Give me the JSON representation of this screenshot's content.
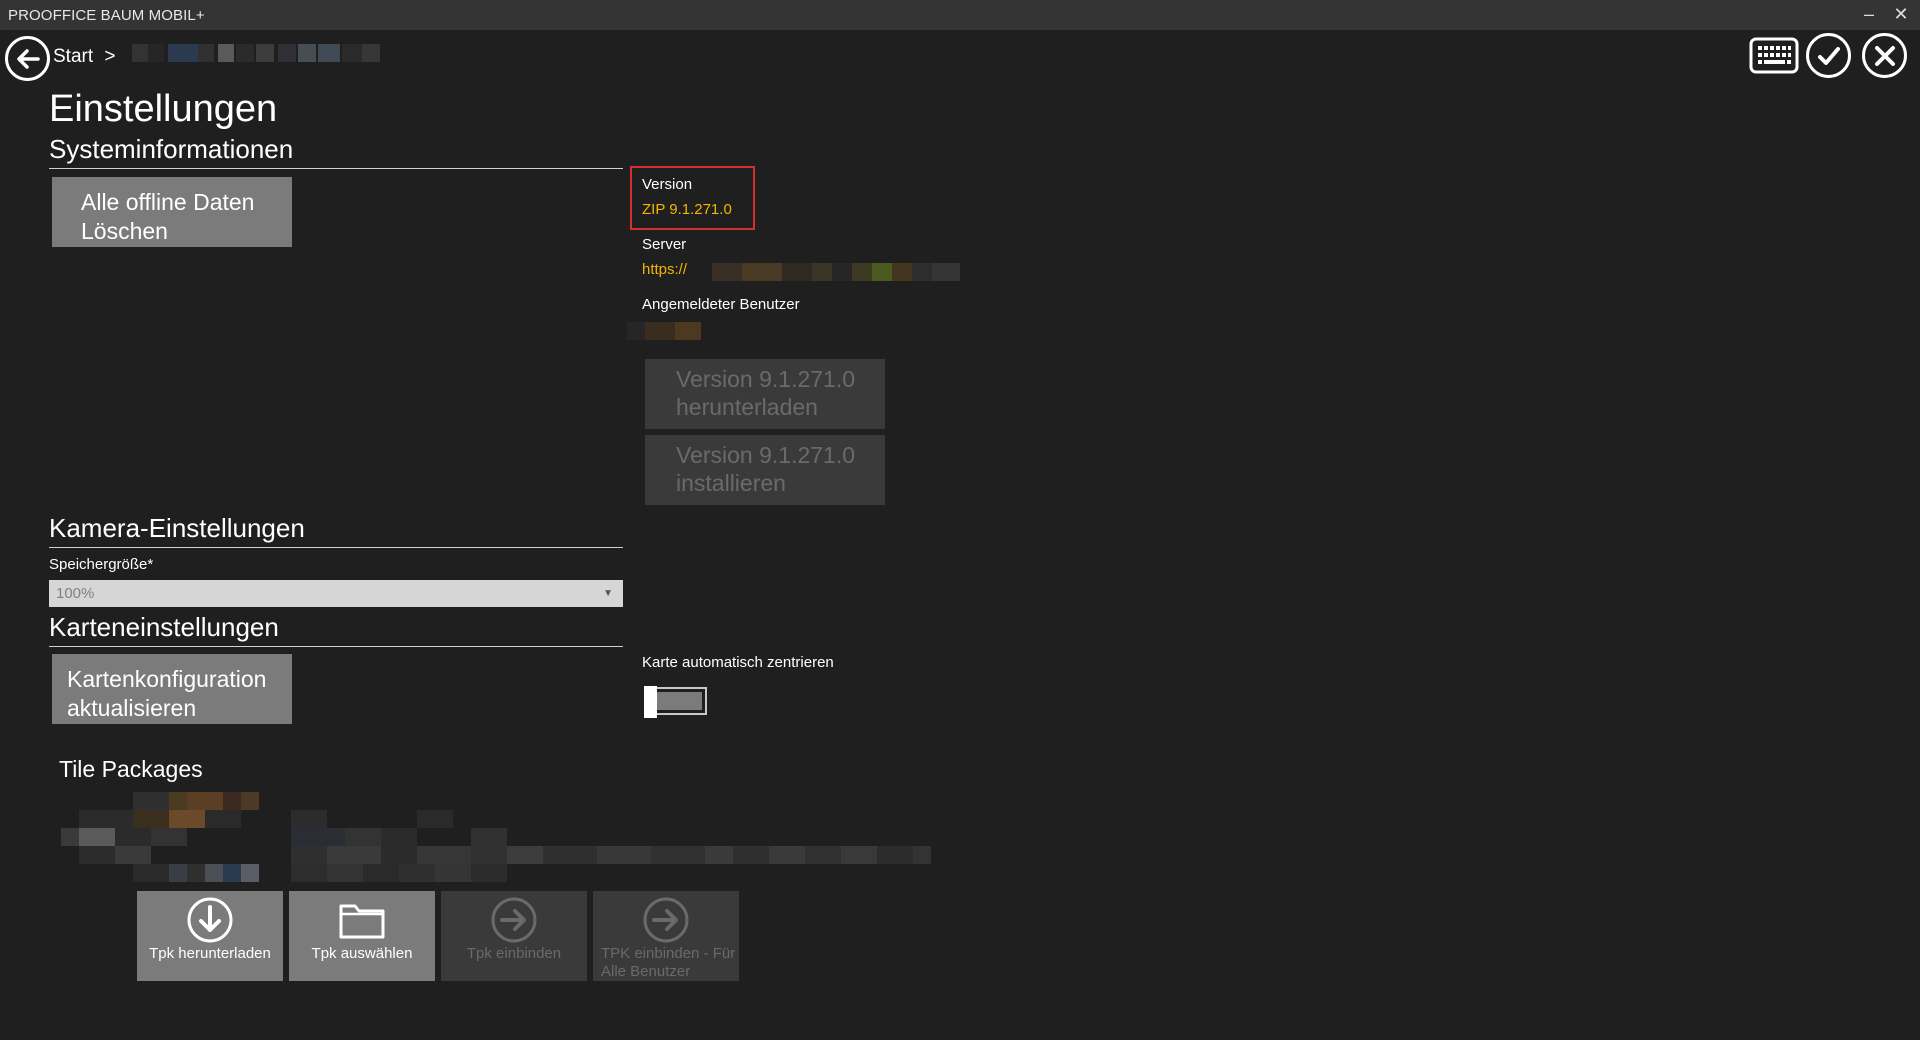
{
  "window": {
    "app_title": "PROOFFICE BAUM MOBIL+",
    "minimize_glyph": "–",
    "close_glyph": "✕"
  },
  "nav": {
    "breadcrumb_start": "Start",
    "breadcrumb_separator": ">",
    "back_icon": "back-arrow-icon",
    "keyboard_icon": "keyboard-icon",
    "accept_icon": "checkmark-icon",
    "cancel_icon": "close-icon"
  },
  "page": {
    "title": "Einstellungen"
  },
  "system_info": {
    "section_title": "Systeminformationen",
    "clear_offline_button": "Alle offline Daten Löschen",
    "version_label": "Version",
    "version_value": "ZIP 9.1.271.0",
    "server_label": "Server",
    "server_value": "https://",
    "user_label": "Angemeldeter Benutzer",
    "download_version_button": "Version 9.1.271.0 herunterladen",
    "install_version_button": "Version 9.1.271.0 installieren"
  },
  "camera": {
    "section_title": "Kamera-Einstellungen",
    "storage_label": "Speichergröße*",
    "storage_value": "100%"
  },
  "map": {
    "section_title": "Karteneinstellungen",
    "update_config_button": "Kartenkonfiguration aktualisieren",
    "auto_center_label": "Karte automatisch zentrieren",
    "auto_center_enabled": false
  },
  "tile_packages": {
    "section_title": "Tile Packages",
    "actions": [
      {
        "label": "Tpk herunterladen",
        "icon": "download-icon",
        "enabled": true
      },
      {
        "label": "Tpk auswählen",
        "icon": "folder-icon",
        "enabled": true
      },
      {
        "label": "Tpk einbinden",
        "icon": "arrow-right-circle-icon",
        "enabled": false
      },
      {
        "label": "TPK einbinden - Für Alle Benutzer",
        "icon": "arrow-right-circle-icon",
        "enabled": false
      }
    ]
  },
  "colors": {
    "background": "#1f1f1f",
    "titlebar": "#343434",
    "accent_yellow": "#f5b400",
    "highlight_red": "#d32f2f",
    "button_gray": "#7b7b7b"
  }
}
